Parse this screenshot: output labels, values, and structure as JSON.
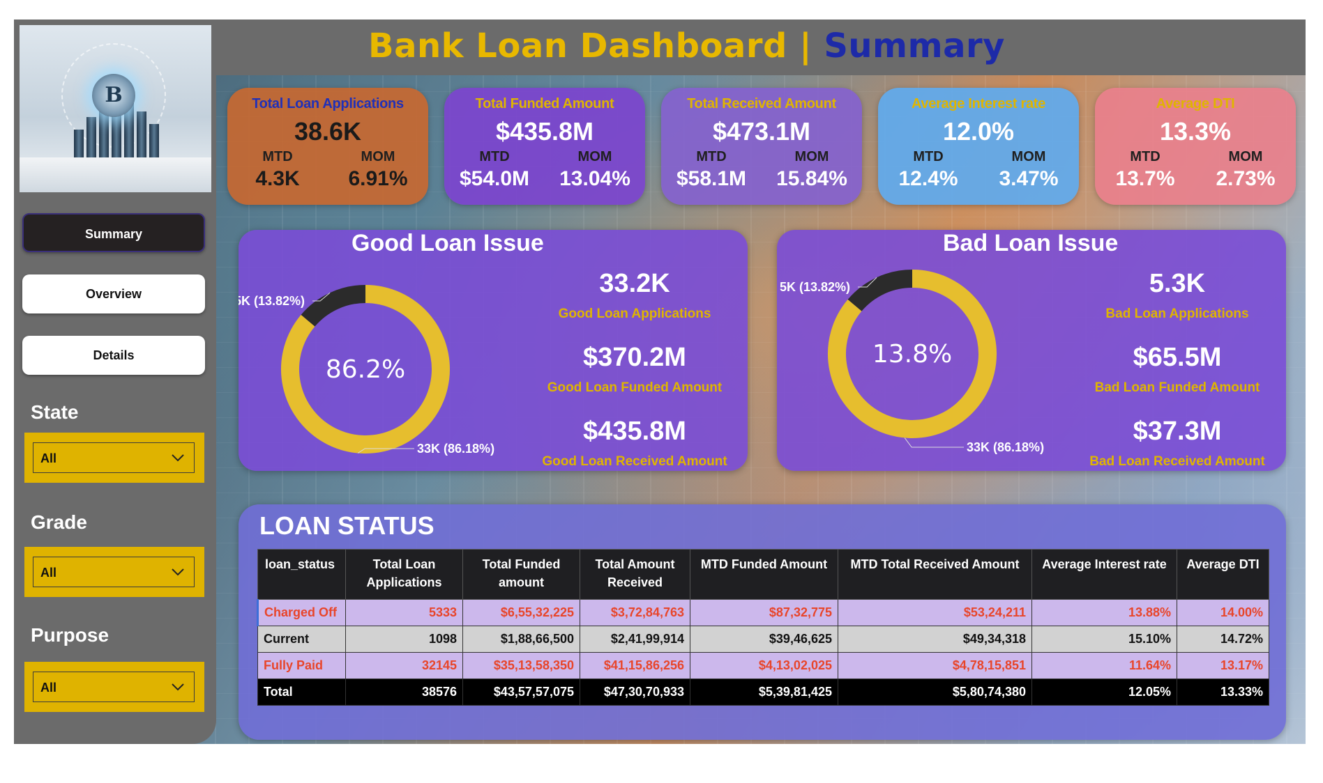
{
  "title": {
    "part1": "Bank Loan Dashboard |",
    "part2": "Summary"
  },
  "nav": {
    "summary": "Summary",
    "overview": "Overview",
    "details": "Details"
  },
  "filters": [
    {
      "label": "State",
      "value": "All"
    },
    {
      "label": "Grade",
      "value": "All"
    },
    {
      "label": "Purpose",
      "value": "All"
    }
  ],
  "kpis": [
    {
      "title": "Total Loan Applications",
      "value": "38.6K",
      "mtd_label": "MTD",
      "mom_label": "MOM",
      "mtd": "4.3K",
      "mom": "6.91%"
    },
    {
      "title": "Total Funded Amount",
      "value": "$435.8M",
      "mtd_label": "MTD",
      "mom_label": "MOM",
      "mtd": "$54.0M",
      "mom": "13.04%"
    },
    {
      "title": "Total Received Amount",
      "value": "$473.1M",
      "mtd_label": "MTD",
      "mom_label": "MOM",
      "mtd": "$58.1M",
      "mom": "15.84%"
    },
    {
      "title": "Average Interest rate",
      "value": "12.0%",
      "mtd_label": "MTD",
      "mom_label": "MOM",
      "mtd": "12.4%",
      "mom": "3.47%"
    },
    {
      "title": "Average DTI",
      "value": "13.3%",
      "mtd_label": "MTD",
      "mom_label": "MOM",
      "mtd": "13.7%",
      "mom": "2.73%"
    }
  ],
  "good_loan": {
    "title": "Good Loan Issue",
    "center": "86.2%",
    "label_small": "5K (13.82%)",
    "label_large": "33K (86.18%)",
    "applications": "33.2K",
    "applications_label": "Good Loan Applications",
    "funded": "$370.2M",
    "funded_label": "Good Loan Funded Amount",
    "received": "$435.8M",
    "received_label": "Good Loan Received Amount"
  },
  "bad_loan": {
    "title": "Bad Loan Issue",
    "center": "13.8%",
    "label_small": "5K (13.82%)",
    "label_large": "33K (86.18%)",
    "applications": "5.3K",
    "applications_label": "Bad Loan Applications",
    "funded": "$65.5M",
    "funded_label": "Bad Loan Funded Amount",
    "received": "$37.3M",
    "received_label": "Bad Loan Received Amount"
  },
  "chart_data": [
    {
      "type": "pie",
      "title": "Good Loan Issue",
      "categories": [
        "Good Loan",
        "Bad Loan"
      ],
      "values": [
        86.18,
        13.82
      ],
      "colors": [
        "#e6be2e",
        "#2b2b2b"
      ]
    },
    {
      "type": "pie",
      "title": "Bad Loan Issue",
      "categories": [
        "Good Loan",
        "Bad Loan"
      ],
      "values": [
        86.18,
        13.82
      ],
      "colors": [
        "#e6be2e",
        "#2b2b2b"
      ]
    }
  ],
  "loan_status": {
    "title": "LOAN STATUS",
    "columns": [
      "loan_status",
      "Total Loan Applications",
      "Total Funded amount",
      "Total Amount Received",
      "MTD Funded Amount",
      "MTD Total Received Amount",
      "Average Interest rate",
      "Average DTI"
    ],
    "rows": [
      [
        "Charged Off",
        "5333",
        "$6,55,32,225",
        "$3,72,84,763",
        "$87,32,775",
        "$53,24,211",
        "13.88%",
        "14.00%"
      ],
      [
        "Current",
        "1098",
        "$1,88,66,500",
        "$2,41,99,914",
        "$39,46,625",
        "$49,34,318",
        "15.10%",
        "14.72%"
      ],
      [
        "Fully Paid",
        "32145",
        "$35,13,58,350",
        "$41,15,86,256",
        "$4,13,02,025",
        "$4,78,15,851",
        "11.64%",
        "13.17%"
      ],
      [
        "Total",
        "38576",
        "$43,57,57,075",
        "$47,30,70,933",
        "$5,39,81,425",
        "$5,80,74,380",
        "12.05%",
        "13.33%"
      ]
    ]
  },
  "colors": {
    "title_gold": "#e8b800",
    "title_blue": "#1d2aa8",
    "panel_purple": "#7a4cd6",
    "slicer_yellow": "#dfb300",
    "donut_yellow": "#e6be2e",
    "donut_dark": "#2b2b2b"
  }
}
